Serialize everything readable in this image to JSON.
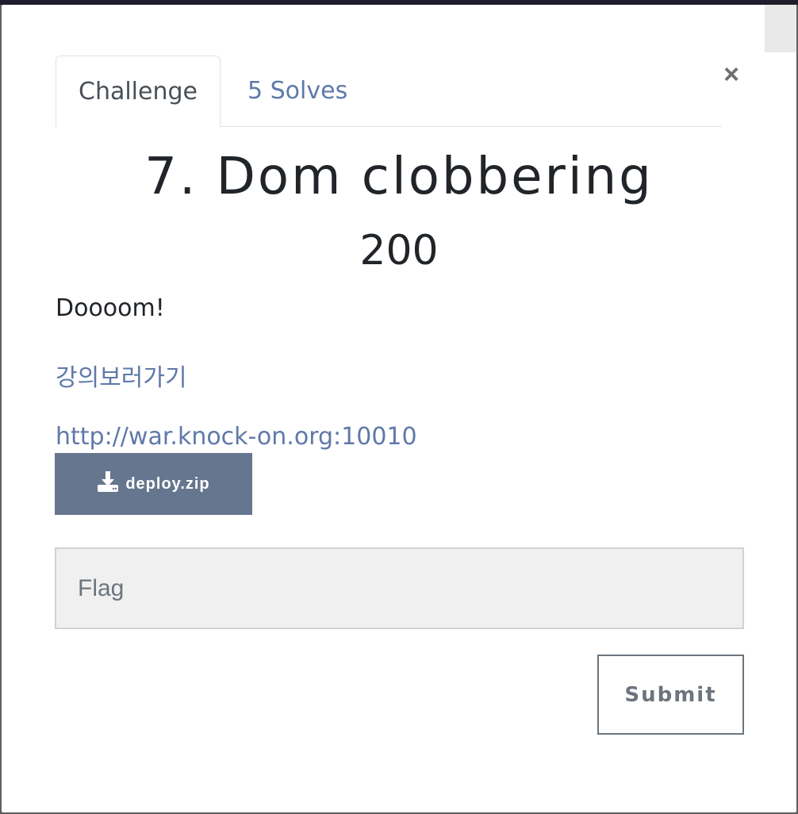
{
  "modal": {
    "tabs": [
      {
        "label": "Challenge"
      },
      {
        "label": "5 Solves"
      }
    ],
    "close_label": "×",
    "challenge": {
      "title": "7. Dom clobbering",
      "value": "200",
      "description": "Doooom!",
      "lecture_link": "강의보러가기",
      "url_link": "http://war.knock-on.org:10010",
      "file_label": "deploy.zip",
      "file_icon": "download-icon"
    },
    "flag": {
      "placeholder": "Flag",
      "value": ""
    },
    "submit_label": "Submit"
  }
}
